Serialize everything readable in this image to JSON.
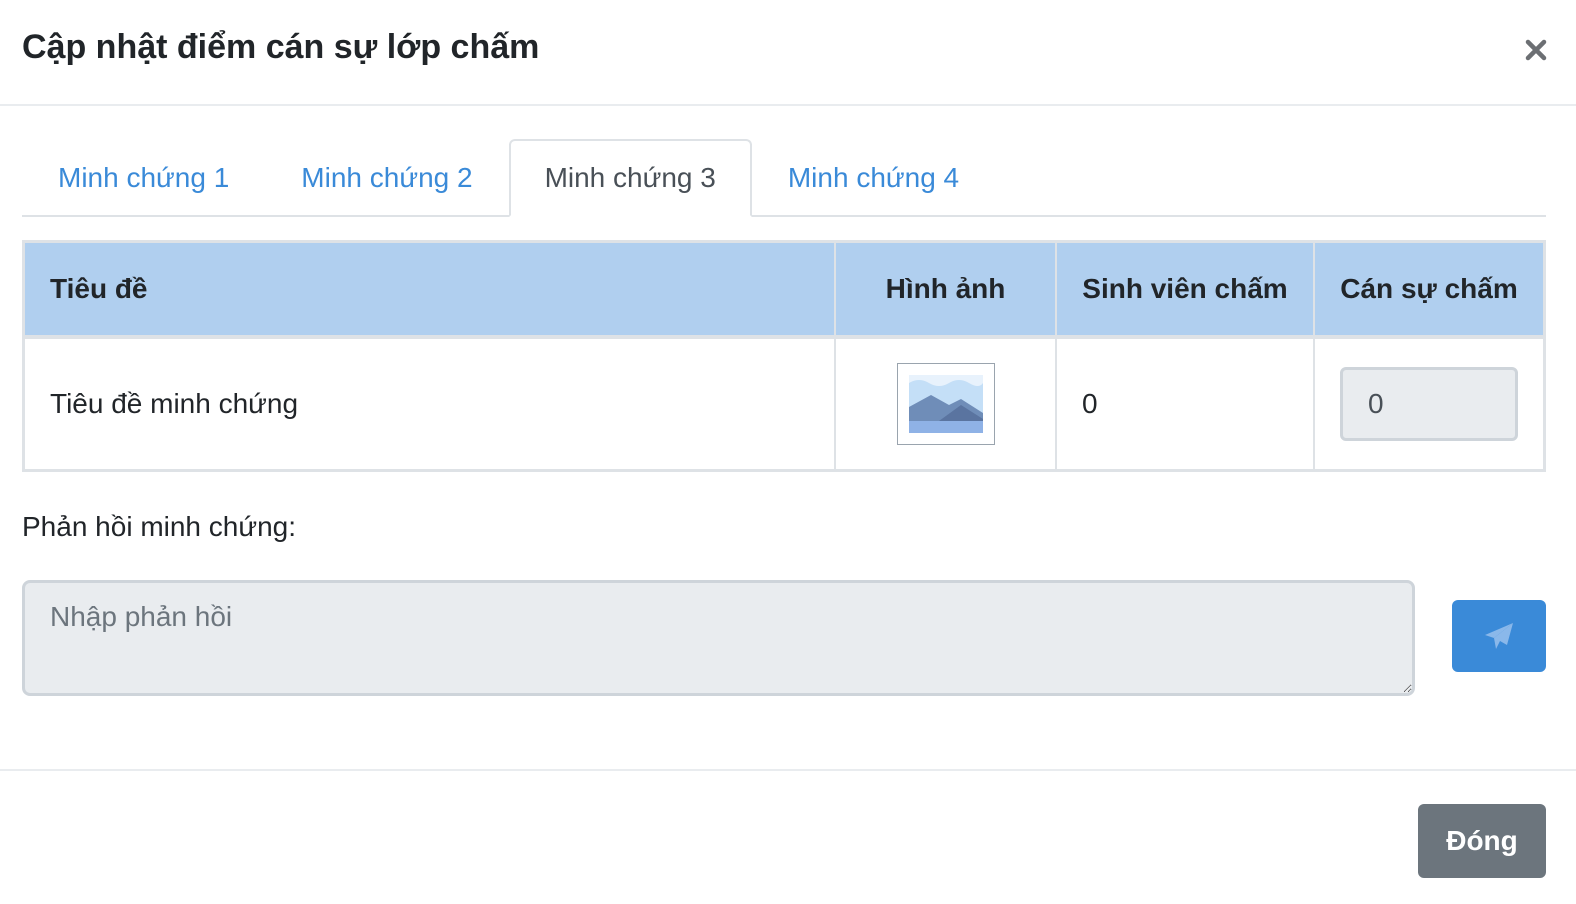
{
  "modal": {
    "title": "Cập nhật điểm cán sự lớp chấm",
    "close_icon": "close-icon"
  },
  "tabs": [
    {
      "label": "Minh chứng 1",
      "active": false
    },
    {
      "label": "Minh chứng 2",
      "active": false
    },
    {
      "label": "Minh chứng 3",
      "active": true
    },
    {
      "label": "Minh chứng 4",
      "active": false
    }
  ],
  "table": {
    "headers": [
      "Tiêu đề",
      "Hình ảnh",
      "Sinh viên chấm",
      "Cán sự chấm"
    ],
    "rows": [
      {
        "title": "Tiêu đề minh chứng",
        "image_icon": "image-placeholder-icon",
        "student_score": "0",
        "monitor_score": "0"
      }
    ]
  },
  "feedback": {
    "label": "Phản hồi minh chứng:",
    "placeholder": "Nhập phản hồi",
    "send_icon": "send-icon"
  },
  "footer": {
    "close_label": "Đóng"
  },
  "colors": {
    "accent": "#3a8ad8",
    "table_header_bg": "#b0cfef",
    "secondary_button": "#6c757d"
  }
}
